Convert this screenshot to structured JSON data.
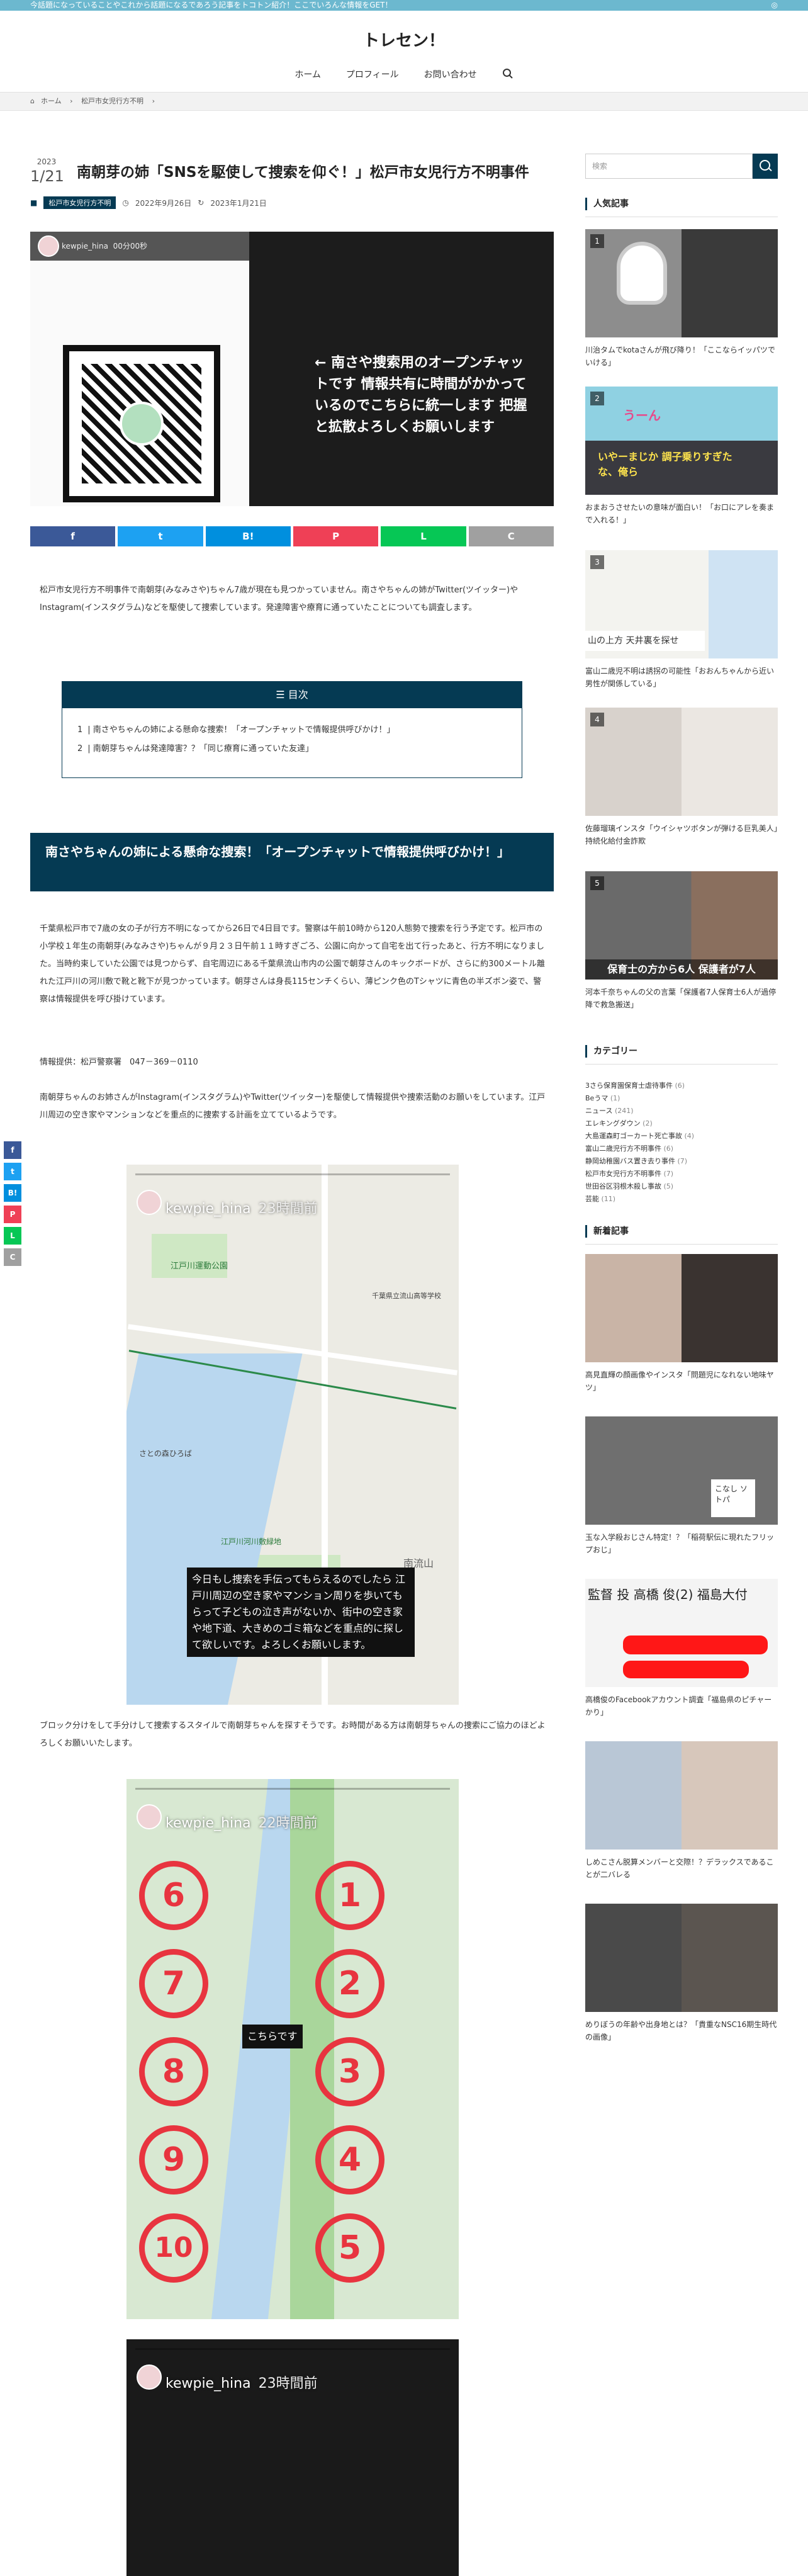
{
  "topbar": {
    "text": "今話題になっていることやこれから話題になるであろう記事をトコトン紹介！ここでいろんな情報をGET！",
    "rss_icon": "rss-icon"
  },
  "site": {
    "title": "トレセン！"
  },
  "nav": {
    "items": [
      "ホーム",
      "プロフィール",
      "お問い合わせ"
    ],
    "search_icon": "search-icon"
  },
  "breadcrumb": {
    "home": "ホーム",
    "category": "松戸市女児行方不明"
  },
  "article": {
    "year": "2023",
    "date": "1/21",
    "title": "南朝芽の姉「SNSを駆使して捜索を仰ぐ！」松戸市女児行方不明事件",
    "category": "松戸市女児行方不明",
    "published": "2022年9月26日",
    "updated": "2023年1月21日",
    "eyecatch": {
      "username": "kewpie_hina",
      "time": "00分00秒",
      "text": "← 南さや捜索用のオープンチャットです 情報共有に時間がかかっているのでこちらに統一します 把握と拡散よろしくお願いします"
    },
    "share_buttons": [
      "f",
      "t",
      "B!",
      "P",
      "L",
      "C"
    ],
    "intro": "松戸市女児行方不明事件で南朝芽(みなみさや)ちゃん7歳が現在も見つかっていません。南さやちゃんの姉がTwitter(ツイッター)やInstagram(インスタグラム)などを駆使して捜索しています。発達障害や療育に通っていたことについても調査します。",
    "toc": {
      "heading": "目次",
      "items": [
        {
          "num": "1",
          "label": "南さやちゃんの姉による懸命な捜索！「オープンチャットで情報提供呼びかけ！」"
        },
        {
          "num": "2",
          "label": "南朝芽ちゃんは発達障害？？「同じ療育に通っていた友達」"
        }
      ]
    },
    "h2": "南さやちゃんの姉による懸命な捜索！「オープンチャットで情報提供呼びかけ！」",
    "p1": "千葉県松戸市で7歳の女の子が行方不明になってから26日で4日目です。警察は午前10時から120人態勢で捜索を行う予定です。松戸市の小学校１年生の南朝芽(みなみさや)ちゃんが９月２３日午前１１時すぎごろ、公園に向かって自宅を出て行ったあと、行方不明になりました。当時約束していた公園では見つからず、自宅周辺にある千葉県流山市内の公園で朝芽さんのキックボードが、さらに約300メートル離れた江戸川の河川敷で靴と靴下が見つかっています。朝芽さんは身長115センチくらい、薄ピンク色のTシャツに青色の半ズボン姿で、警察は情報提供を呼び掛けています。",
    "p2": "情報提供：松戸警察署　047－369－0110",
    "p3": "南朝芽ちゃんのお姉さんがInstagram(インスタグラム)やTwitter(ツイッター)を駆使して情報提供や捜索活動のお願いをしています。江戸川周辺の空き家やマンションなどを重点的に捜索する計画を立てているようです。",
    "story1": {
      "username": "kewpie_hina",
      "time": "23時間前",
      "map_labels": [
        "江戸川運動公園",
        "さとの森ひろば",
        "南流山",
        "江戸川河川敷緑地",
        "千葉県立流山高等学校"
      ],
      "caption": "今日もし捜索を手伝ってもらえるのでしたら 江戸川周辺の空き家やマンション周りを歩いてもらって子どもの泣き声がないか、街中の空き家や地下道、大きめのゴミ箱などを重点的に探して欲しいです。よろしくお願いします。"
    },
    "p4": "ブロック分けをして手分けして捜索するスタイルで南朝芽ちゃんを探すそうです。お時間がある方は南朝芽ちゃんの捜索にご協力のほどよろしくお願いいたします。",
    "story2": {
      "username": "kewpie_hina",
      "time": "22時間前",
      "label": "こちらです",
      "blocks": [
        "1",
        "2",
        "3",
        "4",
        "5",
        "6",
        "7",
        "8",
        "9",
        "10"
      ]
    },
    "story3": {
      "username": "kewpie_hina",
      "time": "23時間前"
    }
  },
  "sidebar": {
    "search_placeholder": "検索",
    "popular_heading": "人気記事",
    "popular": [
      {
        "rank": "1",
        "title": "川治タムでkotaさんが飛び降り！「ここならイッパツでいける」"
      },
      {
        "rank": "2",
        "title": "おまおうさせたいの意味が面白い！「お口にアレを奏まで入れる！」",
        "overlay1": "うーん",
        "overlay2": "いやーまじか 調子乗りすぎたな、俺ら"
      },
      {
        "rank": "3",
        "title": "富山二歳児不明は誘拐の可能性「おおんちゃんから近い男性が関係している」",
        "overlay": "山の上方 天井裏を探せ"
      },
      {
        "rank": "4",
        "title": "佐藤瑠璃インスタ「ウイシャツボタンが弾ける巨乳美人」持続化給付金詐欺"
      },
      {
        "rank": "5",
        "title": "河本千奈ちゃんの父の言葉「保護者7人保育士6人が過停降で救急搬送」",
        "overlay": "保育士の方から6人 保護者が7人"
      }
    ],
    "categories_heading": "カテゴリー",
    "categories": [
      {
        "label": "3さら保育園保育士虐待事件",
        "count": "(6)"
      },
      {
        "label": "Beうマ",
        "count": "(1)"
      },
      {
        "label": "ニュース",
        "count": "(241)"
      },
      {
        "label": "エレキングダウン",
        "count": "(2)"
      },
      {
        "label": "大島運森町ゴーカート死亡事故",
        "count": "(4)"
      },
      {
        "label": "富山二歳児行方不明事件",
        "count": "(6)"
      },
      {
        "label": "静岡幼稚園バス置き去り事件",
        "count": "(7)"
      },
      {
        "label": "松戸市女児行方不明事件",
        "count": "(7)"
      },
      {
        "label": "世田谷区羽根木殺し事故",
        "count": "(5)"
      },
      {
        "label": "芸能",
        "count": "(11)"
      }
    ],
    "new_heading": "新着記事",
    "new": [
      {
        "title": "高見直輝の顔画像やインスタ「問題児になれない地味ヤツ」"
      },
      {
        "title": "玉な入学殺おじさん特定！？「稲荷駅伝に現れたフリップおじ」",
        "overlay": "こなし ソトパ"
      },
      {
        "title": "高橋俊のFacebookアカウント調査「福島県のピチャーかり」",
        "overlay": "監督 投 高橋 俊(2) 福島大付"
      },
      {
        "title": "しめこさん脱算メンバーと交際！？デラックスであることが二バレる"
      },
      {
        "title": "めりぼうの年齢や出身地とは？「貴重なNSC16期生時代の画像」"
      }
    ]
  },
  "floatshare": [
    "f",
    "t",
    "B!",
    "P",
    "L",
    "C"
  ],
  "colors": {
    "primary": "#053a53",
    "topbar": "#6cb8cf",
    "facebook": "#3b5998",
    "twitter": "#1da1f2",
    "hatena": "#008fde",
    "pocket": "#ef4056",
    "line": "#06c755",
    "copy": "#a0a0a0"
  }
}
